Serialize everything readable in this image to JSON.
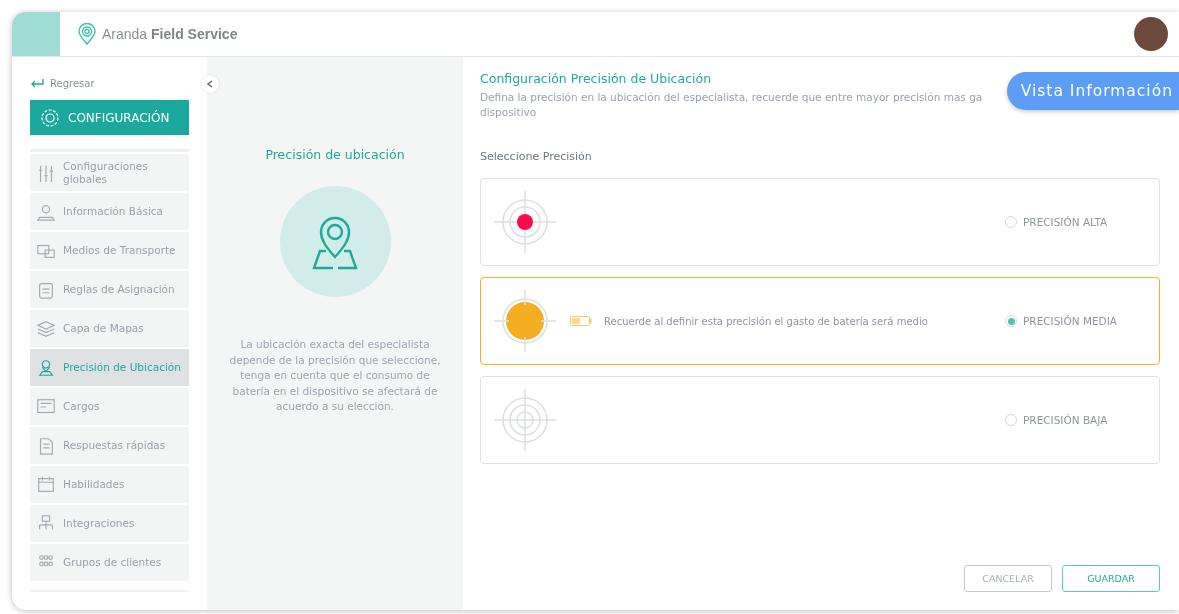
{
  "header": {
    "brand_light": "Aranda",
    "brand_bold": "Field Service"
  },
  "sidebar": {
    "back_link": "Regresar",
    "section_button": "CONFIGURACIÓN",
    "items": [
      {
        "label": "Configuraciones globales",
        "selected": false
      },
      {
        "label": "Información Básica",
        "selected": false
      },
      {
        "label": "Medios de Transporte",
        "selected": false
      },
      {
        "label": "Reglas de Asignación",
        "selected": false
      },
      {
        "label": "Capa de Mapas",
        "selected": false
      },
      {
        "label": "Precisión de Ubicación",
        "selected": true
      },
      {
        "label": "Cargos",
        "selected": false
      },
      {
        "label": "Respuestas rápidas",
        "selected": false
      },
      {
        "label": "Habilidades",
        "selected": false
      },
      {
        "label": "Integraciones",
        "selected": false
      },
      {
        "label": "Grupos de clientes",
        "selected": false
      }
    ]
  },
  "info_panel": {
    "title": "Precisión de ubicación",
    "text": "La ubicación exacta del especialista depende de la precisión que seleccione, tenga en cuenta que el consumo de batería en el dispositivo se afectará de acuerdo a su elección."
  },
  "main": {
    "title": "Configuración Precisión de Ubicación",
    "description_line_1": "Defina la precisión en la ubicación del especialista, recuerde que entre mayor precisión mas ga",
    "description_line_2": "dispositivo",
    "select_label": "Seleccione Precisión",
    "options": [
      {
        "kind": "small-dot",
        "color": "#ff0a4f",
        "label": "PRECISIÓN ALTA",
        "selected": false
      },
      {
        "kind": "large-dot",
        "color": "#f5ae22",
        "label": "PRECISIÓN MEDIA",
        "note": "Recuerde al definir esta precisión el gasto de batería será medio",
        "selected": true
      },
      {
        "kind": "ring",
        "label": "PRECISIÓN BAJA",
        "selected": false
      }
    ],
    "buttons": [
      {
        "kind": "secondary",
        "label": "CANCELAR"
      },
      {
        "kind": "primary",
        "label": "GUARDAR"
      }
    ]
  },
  "overlay_button": "Vista Información"
}
